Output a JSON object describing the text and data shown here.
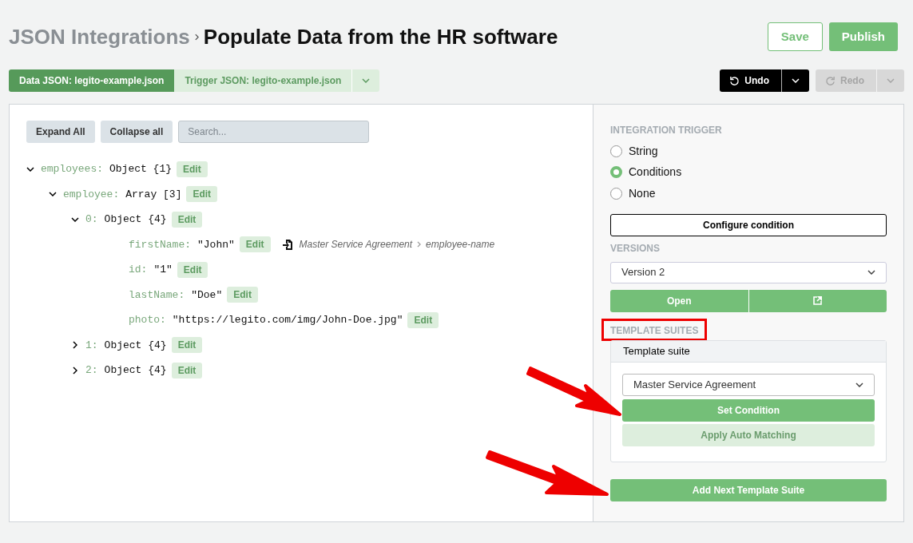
{
  "breadcrumb": {
    "parent": "JSON Integrations",
    "title": "Populate Data from the HR software"
  },
  "header_buttons": [
    {
      "label": "Save",
      "kind": "outline"
    },
    {
      "label": "Publish",
      "kind": "solid"
    }
  ],
  "json_tabs": [
    {
      "label": "Data JSON: legito-example.json",
      "selected": true
    },
    {
      "label": "Trigger JSON: legito-example.json",
      "selected": false
    }
  ],
  "history": [
    {
      "label": "Undo",
      "kind": "undo",
      "disabled": false
    },
    {
      "label": "Redo",
      "kind": "redo",
      "disabled": true
    }
  ],
  "toolbar": {
    "buttons": [
      "Expand All",
      "Collapse all"
    ],
    "search": {
      "placeholder": "Search..."
    }
  },
  "tree": [
    {
      "key": "employees:",
      "value": "Object {1}",
      "edit": "Edit",
      "expanded": true,
      "children": [
        {
          "key": "employee:",
          "value": "Array [3]",
          "edit": "Edit",
          "expanded": true,
          "children": [
            {
              "key": "0:",
              "value": "Object {4}",
              "edit": "Edit",
              "expanded": true,
              "children": [
                {
                  "key": "firstName:",
                  "value": "\"John\"",
                  "edit": "Edit",
                  "mapping": [
                    "Master Service Agreement",
                    "employee-name"
                  ]
                },
                {
                  "key": "id:",
                  "value": "\"1\"",
                  "edit": "Edit"
                },
                {
                  "key": "lastName:",
                  "value": "\"Doe\"",
                  "edit": "Edit"
                },
                {
                  "key": "photo:",
                  "value": "\"https://legito.com/img/John-Doe.jpg\"",
                  "edit": "Edit"
                }
              ]
            },
            {
              "key": "1:",
              "value": "Object {4}",
              "edit": "Edit",
              "expanded": false
            },
            {
              "key": "2:",
              "value": "Object {4}",
              "edit": "Edit",
              "expanded": false
            }
          ]
        }
      ]
    }
  ],
  "sidebar": {
    "trigger_heading": "INTEGRATION TRIGGER",
    "trigger_options": [
      {
        "label": "String",
        "selected": false
      },
      {
        "label": "Conditions",
        "selected": true
      },
      {
        "label": "None",
        "selected": false
      }
    ],
    "configure_button": "Configure condition",
    "versions_heading": "VERSIONS",
    "version_select": "Version 2",
    "open_button": "Open",
    "suites_heading": "TEMPLATE SUITES",
    "suite_card": {
      "title": "Template suite",
      "select": "Master Service Agreement",
      "set_button": "Set Condition",
      "auto_button": "Apply Auto Matching"
    },
    "add_button": "Add Next Template Suite"
  }
}
